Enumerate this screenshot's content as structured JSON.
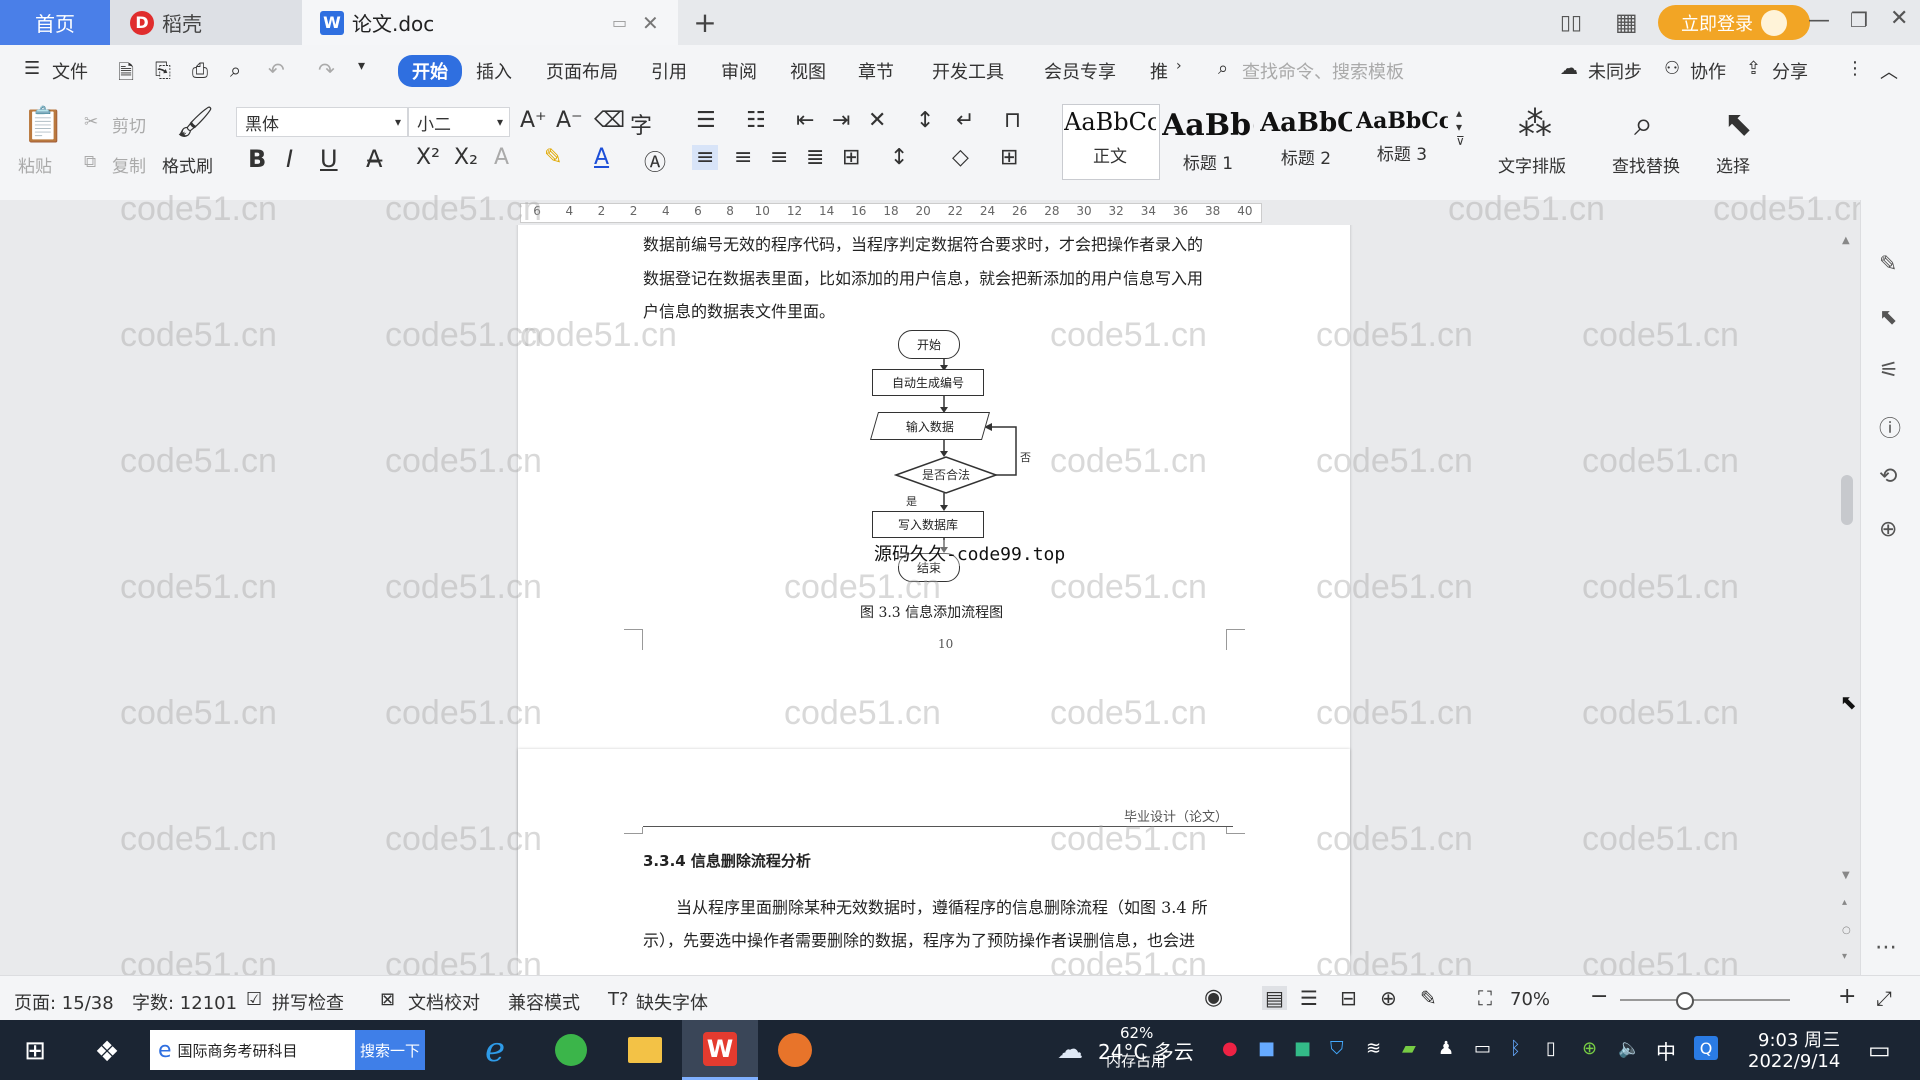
{
  "tabs": {
    "home": "首页",
    "daoke": "稻壳",
    "doc": "论文.doc",
    "new_tab": "+"
  },
  "window": {
    "login": "立即登录"
  },
  "menu": {
    "file": "文件",
    "items": [
      "开始",
      "插入",
      "页面布局",
      "引用",
      "审阅",
      "视图",
      "章节",
      "开发工具",
      "会员专享",
      "推"
    ],
    "search_placeholder": "查找命令、搜索模板",
    "sync": "未同步",
    "collab": "协作",
    "share": "分享"
  },
  "ribbon": {
    "paste": "粘贴",
    "cut": "剪切",
    "copy": "复制",
    "format_painter": "格式刷",
    "font_name": "黑体",
    "font_size": "小二",
    "styles": [
      {
        "sample": "AaBbCcI",
        "label": "正文"
      },
      {
        "sample": "AaBb(",
        "label": "标题 1"
      },
      {
        "sample": "AaBbC",
        "label": "标题 2"
      },
      {
        "sample": "AaBbCcI",
        "label": "标题 3"
      }
    ],
    "text_layout": "文字排版",
    "find_replace": "查找替换",
    "select": "选择"
  },
  "ruler_ticks": [
    "6",
    "4",
    "2",
    "2",
    "4",
    "6",
    "8",
    "10",
    "12",
    "14",
    "16",
    "18",
    "20",
    "22",
    "24",
    "26",
    "28",
    "30",
    "32",
    "34",
    "36",
    "38",
    "40"
  ],
  "page1": {
    "line0": "数据前编号无效的程序代码，当程序判定数据符合要求时，才会把操作者录入的",
    "line1": "数据登记在数据表里面，比如添加的用户信息，就会把新添加的用户信息写入用",
    "line2": "户信息的数据表文件里面。",
    "flow": {
      "start": "开始",
      "auto": "自动生成编号",
      "input": "输入数据",
      "check": "是否合法",
      "no": "否",
      "yes": "是",
      "write": "写入数据库",
      "end": "结束"
    },
    "overlay": "源码久久-code99.top",
    "caption": "图 3.3  信息添加流程图",
    "page_num": "10"
  },
  "page2": {
    "header": "毕业设计（论文）",
    "heading": "3.3.4  信息删除流程分析",
    "para1": "当从程序里面删除某种无效数据时，遵循程序的信息删除流程（如图 3.4 所",
    "para2": "示），先要选中操作者需要删除的数据，程序为了预防操作者误删信息，也会进"
  },
  "watermark": "code51.cn",
  "status": {
    "page": "页面: 15/38",
    "words": "字数: 12101",
    "spell": "拼写检查",
    "proof": "文档校对",
    "compat": "兼容模式",
    "missing_font": "缺失字体",
    "zoom": "70%"
  },
  "taskbar": {
    "search_text": "国际商务考研科目",
    "search_btn": "搜索一下",
    "weather_temp": "24°C 多云",
    "mem_pct": "62%",
    "mem_label": "内存占用",
    "ime": "中",
    "time": "9:03 周三",
    "date": "2022/9/14"
  },
  "colors": {
    "accent": "#2f6fe0",
    "login": "#f2a525",
    "taskbar": "#1b2533"
  }
}
